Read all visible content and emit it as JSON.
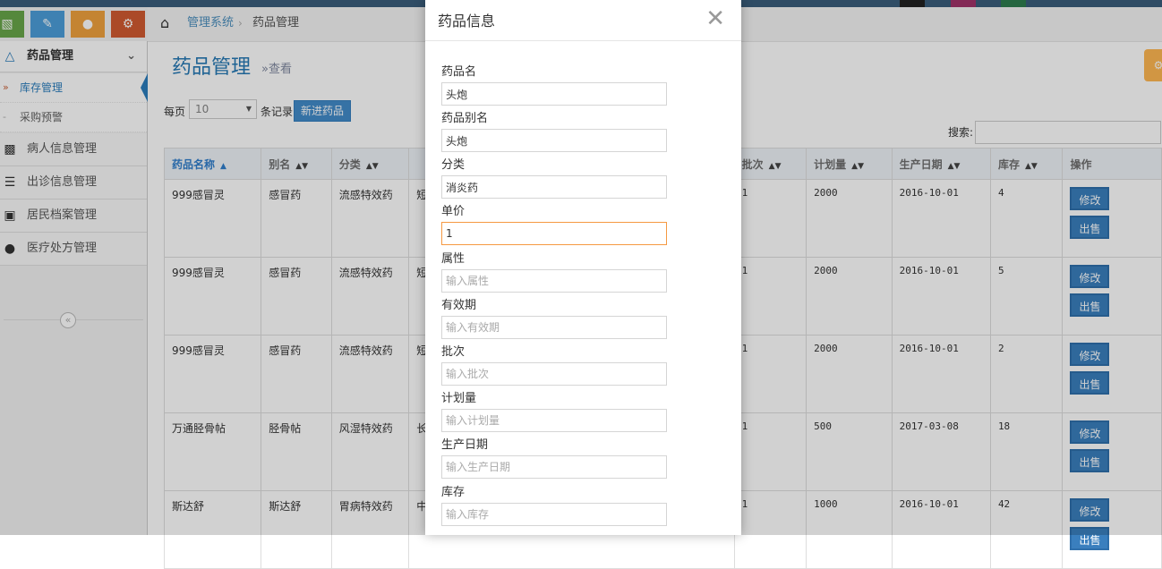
{
  "breadcrumb": {
    "home": "管理系统",
    "current": "药品管理"
  },
  "sidebar": {
    "main": "药品管理",
    "subitems": [
      "库存管理",
      "采购预警"
    ],
    "items": [
      "病人信息管理",
      "出诊信息管理",
      "居民档案管理",
      "医疗处方管理"
    ]
  },
  "page": {
    "title": "药品管理",
    "subtitle": "»查看"
  },
  "controls": {
    "per_page_label": "每页",
    "per_page_value": "10",
    "records_label": "条记录",
    "new_button": "新进药品",
    "search_label": "搜索:"
  },
  "table": {
    "headers": [
      "药品名称",
      "别名",
      "分类",
      "",
      "批次",
      "计划量",
      "生产日期",
      "库存",
      "操作"
    ],
    "rows": [
      [
        "999感冒灵",
        "感冒药",
        "流感特效药",
        "短",
        "1",
        "2000",
        "2016-10-01",
        "4"
      ],
      [
        "999感冒灵",
        "感冒药",
        "流感特效药",
        "短",
        "1",
        "2000",
        "2016-10-01",
        "5"
      ],
      [
        "999感冒灵",
        "感冒药",
        "流感特效药",
        "短",
        "1",
        "2000",
        "2016-10-01",
        "2"
      ],
      [
        "万通胫骨帖",
        "胫骨帖",
        "风湿特效药",
        "长",
        "1",
        "500",
        "2017-03-08",
        "18"
      ],
      [
        "斯达舒",
        "斯达舒",
        "胃病特效药",
        "中",
        "1",
        "1000",
        "2016-10-01",
        "42"
      ]
    ],
    "edit_label": "修改",
    "sell_label": "出售"
  },
  "modal": {
    "title": "药品信息",
    "fields": [
      {
        "label": "药品名",
        "value": "头炮",
        "placeholder": ""
      },
      {
        "label": "药品别名",
        "value": "头炮",
        "placeholder": ""
      },
      {
        "label": "分类",
        "value": "消炎药",
        "placeholder": ""
      },
      {
        "label": "单价",
        "value": "1",
        "placeholder": ""
      },
      {
        "label": "属性",
        "value": "",
        "placeholder": "输入属性"
      },
      {
        "label": "有效期",
        "value": "",
        "placeholder": "输入有效期"
      },
      {
        "label": "批次",
        "value": "",
        "placeholder": "输入批次"
      },
      {
        "label": "计划量",
        "value": "",
        "placeholder": "输入计划量"
      },
      {
        "label": "生产日期",
        "value": "",
        "placeholder": "输入生产日期"
      },
      {
        "label": "库存",
        "value": "",
        "placeholder": "输入库存"
      }
    ]
  },
  "colors": {
    "accent": "#2b7dbc",
    "button": "#3a7fbe",
    "focus": "#f59942"
  }
}
